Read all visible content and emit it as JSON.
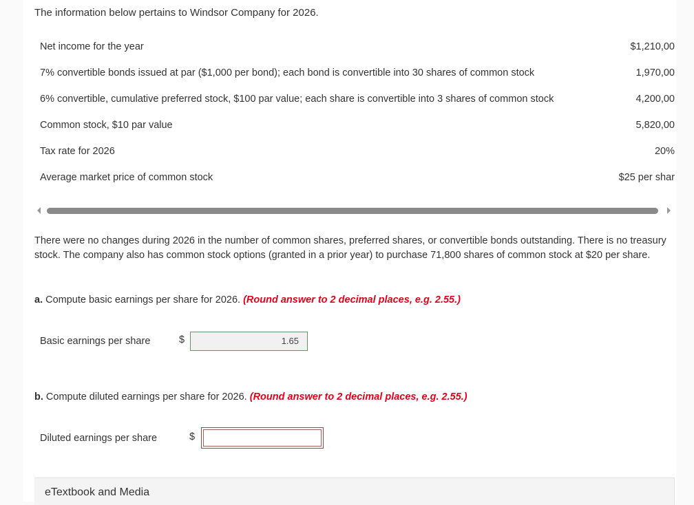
{
  "intro": "The information below pertains to Windsor Company for 2026.",
  "data_table": [
    {
      "label": "Net income for the year",
      "value": "$1,210,00"
    },
    {
      "label": "7% convertible bonds issued at par ($1,000 per bond); each bond is convertible into 30 shares of common stock",
      "value": "1,970,00"
    },
    {
      "label": "6% convertible, cumulative preferred stock, $100 par value; each share is convertible into 3 shares of common stock",
      "value": "4,200,00"
    },
    {
      "label": "Common stock, $10 par value",
      "value": "5,820,00"
    },
    {
      "label": "Tax rate for 2026",
      "value": "20%"
    },
    {
      "label": "Average market price of common stock",
      "value": "$25 per shar"
    }
  ],
  "paragraph": "There were no changes during 2026 in the number of common shares, preferred shares, or convertible bonds outstanding. There is no treasury stock. The company also has common stock options (granted in a prior year) to purchase 71,800 shares of common stock at $20 per share.",
  "part_a": {
    "prefix": "a.",
    "question": " Compute basic earnings per share for 2026. ",
    "hint": "(Round answer to 2 decimal places, e.g. 2.55.)",
    "answer_label": "Basic earnings per share",
    "currency": "$",
    "answer_value": "1.65"
  },
  "part_b": {
    "prefix": "b.",
    "question": " Compute diluted earnings per share for 2026. ",
    "hint": "(Round answer to 2 decimal places, e.g. 2.55.)",
    "answer_label": "Diluted earnings per share",
    "currency": "$",
    "answer_value": ""
  },
  "etextbook": "eTextbook and Media"
}
